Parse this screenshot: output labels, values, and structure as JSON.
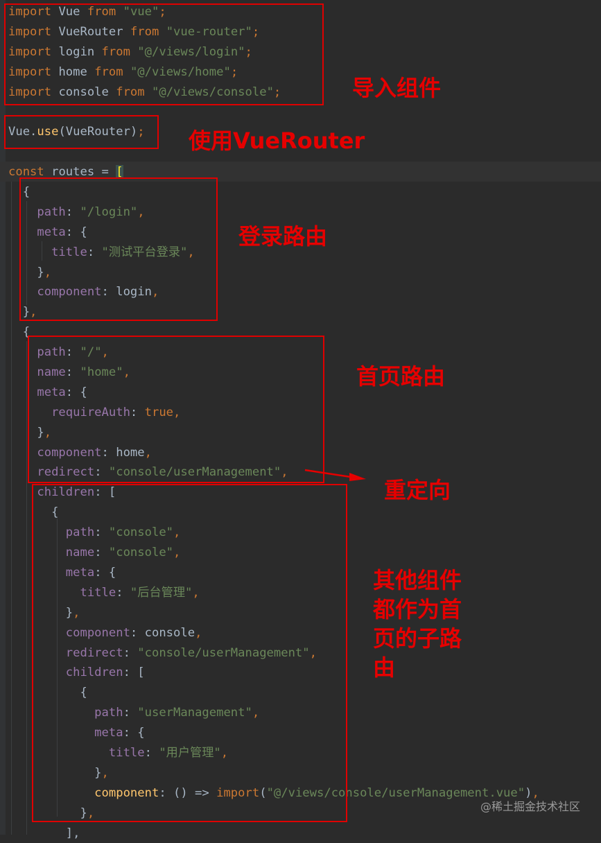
{
  "code_lines": [
    [
      [
        "kw",
        "import"
      ],
      [
        "t",
        " Vue "
      ],
      [
        "kw",
        "from"
      ],
      [
        "t",
        " "
      ],
      [
        "str",
        "\"vue\""
      ],
      [
        "kw",
        ";"
      ]
    ],
    [
      [
        "kw",
        "import"
      ],
      [
        "t",
        " VueRouter "
      ],
      [
        "kw",
        "from"
      ],
      [
        "t",
        " "
      ],
      [
        "str",
        "\"vue-router\""
      ],
      [
        "kw",
        ";"
      ]
    ],
    [
      [
        "kw",
        "import"
      ],
      [
        "t",
        " login "
      ],
      [
        "kw",
        "from"
      ],
      [
        "t",
        " "
      ],
      [
        "str",
        "\"@/views/login\""
      ],
      [
        "kw",
        ";"
      ]
    ],
    [
      [
        "kw",
        "import"
      ],
      [
        "t",
        " home "
      ],
      [
        "kw",
        "from"
      ],
      [
        "t",
        " "
      ],
      [
        "str",
        "\"@/views/home\""
      ],
      [
        "kw",
        ";"
      ]
    ],
    [
      [
        "kw",
        "import"
      ],
      [
        "t",
        " console "
      ],
      [
        "kw",
        "from"
      ],
      [
        "t",
        " "
      ],
      [
        "str",
        "\"@/views/console\""
      ],
      [
        "kw",
        ";"
      ]
    ],
    [],
    [
      [
        "t",
        "Vue."
      ],
      [
        "fn",
        "use"
      ],
      [
        "t",
        "(VueRouter)"
      ],
      [
        "kw",
        ";"
      ]
    ],
    [],
    [
      [
        "kw",
        "const"
      ],
      [
        "t",
        " routes = "
      ],
      [
        "hl",
        "["
      ]
    ],
    [
      [
        "t",
        "  {"
      ]
    ],
    [
      [
        "prop",
        "    path"
      ],
      [
        "t",
        ": "
      ],
      [
        "str",
        "\"/login\""
      ],
      [
        "kw",
        ","
      ]
    ],
    [
      [
        "prop",
        "    meta"
      ],
      [
        "t",
        ": {"
      ]
    ],
    [
      [
        "prop",
        "      title"
      ],
      [
        "t",
        ": "
      ],
      [
        "str",
        "\"测试平台登录\""
      ],
      [
        "kw",
        ","
      ]
    ],
    [
      [
        "t",
        "    }"
      ],
      [
        "kw",
        ","
      ]
    ],
    [
      [
        "prop",
        "    component"
      ],
      [
        "t",
        ": login"
      ],
      [
        "kw",
        ","
      ]
    ],
    [
      [
        "t",
        "  }"
      ],
      [
        "kw",
        ","
      ]
    ],
    [
      [
        "t",
        "  {"
      ]
    ],
    [
      [
        "prop",
        "    path"
      ],
      [
        "t",
        ": "
      ],
      [
        "str",
        "\"/\""
      ],
      [
        "kw",
        ","
      ]
    ],
    [
      [
        "prop",
        "    name"
      ],
      [
        "t",
        ": "
      ],
      [
        "str",
        "\"home\""
      ],
      [
        "kw",
        ","
      ]
    ],
    [
      [
        "prop",
        "    meta"
      ],
      [
        "t",
        ": {"
      ]
    ],
    [
      [
        "prop",
        "      requireAuth"
      ],
      [
        "t",
        ": "
      ],
      [
        "kw",
        "true"
      ],
      [
        "kw",
        ","
      ]
    ],
    [
      [
        "t",
        "    }"
      ],
      [
        "kw",
        ","
      ]
    ],
    [
      [
        "prop",
        "    component"
      ],
      [
        "t",
        ": home"
      ],
      [
        "kw",
        ","
      ]
    ],
    [
      [
        "prop",
        "    redirect"
      ],
      [
        "t",
        ": "
      ],
      [
        "str",
        "\"console/userManagement\""
      ],
      [
        "kw",
        ","
      ]
    ],
    [
      [
        "prop",
        "    children"
      ],
      [
        "t",
        ": ["
      ]
    ],
    [
      [
        "t",
        "      {"
      ]
    ],
    [
      [
        "prop",
        "        path"
      ],
      [
        "t",
        ": "
      ],
      [
        "str",
        "\"console\""
      ],
      [
        "kw",
        ","
      ]
    ],
    [
      [
        "prop",
        "        name"
      ],
      [
        "t",
        ": "
      ],
      [
        "str",
        "\"console\""
      ],
      [
        "kw",
        ","
      ]
    ],
    [
      [
        "prop",
        "        meta"
      ],
      [
        "t",
        ": {"
      ]
    ],
    [
      [
        "prop",
        "          title"
      ],
      [
        "t",
        ": "
      ],
      [
        "str",
        "\"后台管理\""
      ],
      [
        "kw",
        ","
      ]
    ],
    [
      [
        "t",
        "        }"
      ],
      [
        "kw",
        ","
      ]
    ],
    [
      [
        "prop",
        "        component"
      ],
      [
        "t",
        ": console"
      ],
      [
        "kw",
        ","
      ]
    ],
    [
      [
        "prop",
        "        redirect"
      ],
      [
        "t",
        ": "
      ],
      [
        "str",
        "\"console/userManagement\""
      ],
      [
        "kw",
        ","
      ]
    ],
    [
      [
        "prop",
        "        children"
      ],
      [
        "t",
        ": ["
      ]
    ],
    [
      [
        "t",
        "          {"
      ]
    ],
    [
      [
        "prop",
        "            path"
      ],
      [
        "t",
        ": "
      ],
      [
        "str",
        "\"userManagement\""
      ],
      [
        "kw",
        ","
      ]
    ],
    [
      [
        "prop",
        "            meta"
      ],
      [
        "t",
        ": {"
      ]
    ],
    [
      [
        "prop",
        "              title"
      ],
      [
        "t",
        ": "
      ],
      [
        "str",
        "\"用户管理\""
      ],
      [
        "kw",
        ","
      ]
    ],
    [
      [
        "t",
        "            }"
      ],
      [
        "kw",
        ","
      ]
    ],
    [
      [
        "fn",
        "            component"
      ],
      [
        "t",
        ": () => "
      ],
      [
        "kw",
        "import"
      ],
      [
        "t",
        "("
      ],
      [
        "str",
        "\"@/views/console/userManagement.vue\""
      ],
      [
        "t",
        ")"
      ],
      [
        "kw",
        ","
      ]
    ],
    [
      [
        "t",
        "          }"
      ],
      [
        "kw",
        ","
      ]
    ],
    [
      [
        "t",
        "        ],"
      ]
    ]
  ],
  "annotations": {
    "import_components": "导入组件",
    "use_router": "使用VueRouter",
    "login_route": "登录路由",
    "home_route": "首页路由",
    "redirect": "重定向",
    "children_note": "其他组件\n都作为首\n页的子路\n由"
  },
  "watermark": "@稀土掘金技术社区",
  "colors": {
    "background": "#2b2b2b",
    "keyword": "#cc7832",
    "string": "#6a8759",
    "property": "#9876aa",
    "function": "#ffc66d",
    "annotation": "#e60000"
  }
}
